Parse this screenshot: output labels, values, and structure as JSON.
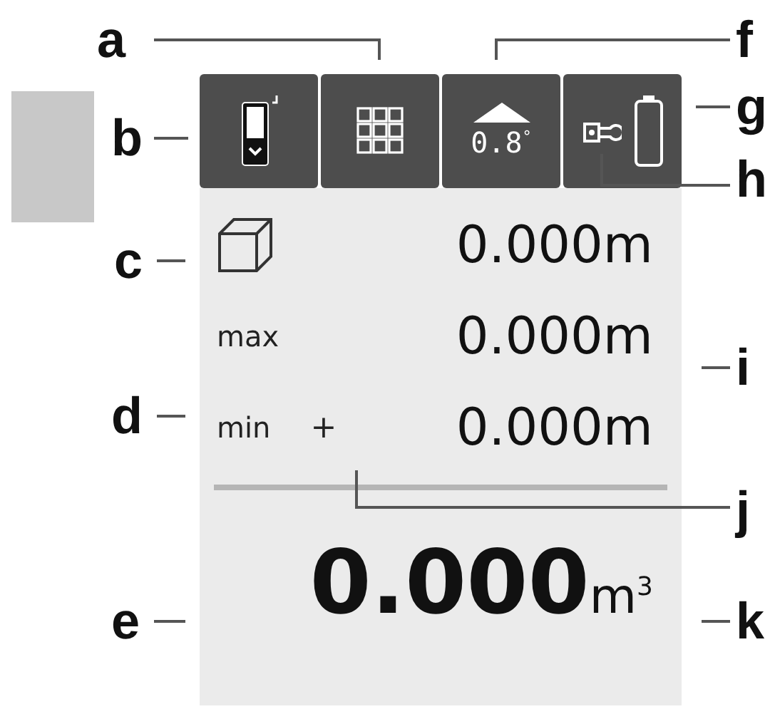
{
  "callouts": [
    {
      "letter": "a"
    },
    {
      "letter": "b"
    },
    {
      "letter": "c"
    },
    {
      "letter": "d"
    },
    {
      "letter": "e"
    },
    {
      "letter": "f"
    },
    {
      "letter": "g"
    },
    {
      "letter": "h"
    },
    {
      "letter": "i"
    },
    {
      "letter": "j"
    },
    {
      "letter": "k"
    }
  ],
  "toolbar": [
    {
      "kind": "device"
    },
    {
      "kind": "grid"
    },
    {
      "kind": "tilt",
      "reading": "0.8",
      "unit": "°"
    },
    {
      "kind": "battery"
    }
  ],
  "rows": [
    {
      "kind": "icon",
      "value": "0.000m"
    },
    {
      "kind": "text",
      "label": "max",
      "value": "0.000m"
    },
    {
      "kind": "text",
      "label": "min",
      "marker": "+",
      "value": "0.000m"
    }
  ],
  "result": {
    "value": "0.000",
    "unit": "m$^{3}$"
  }
}
